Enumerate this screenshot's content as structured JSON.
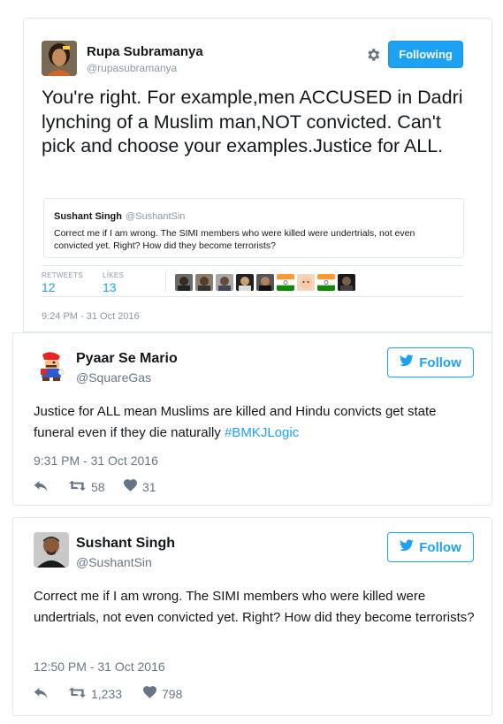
{
  "tweet_main": {
    "author_name": "Rupa Subramanya",
    "author_handle": "@rupasubramanya",
    "following_label": "Following",
    "text": "You're right. For example,men ACCUSED in Dadri lynching of a Muslim man,NOT convicted. Can't pick and choose your examples.Justice for ALL.",
    "quote": {
      "author_name": "Sushant Singh",
      "author_handle": "@SushantSin",
      "text": "Correct me if I am wrong. The SIMI members who were killed were undertrials, not even convicted yet. Right? How did they become terrorists?"
    },
    "stats": {
      "retweets_label": "RETWEETS",
      "retweets_value": "12",
      "likes_label": "LIKES",
      "likes_value": "13"
    },
    "timestamp": "9:24 PM - 31 Oct 2016"
  },
  "tweet_mario": {
    "author_name": "Pyaar Se Mario",
    "author_handle": "@SquareGas",
    "follow_label": "Follow",
    "text_main": "Justice for ALL mean Muslims are killed and Hindu convicts get state funeral even if they die naturally ",
    "hashtag": "#BMKJLogic",
    "timestamp": "9:31 PM - 31 Oct 2016",
    "retweets": "58",
    "likes": "31"
  },
  "tweet_sushant": {
    "author_name": "Sushant Singh",
    "author_handle": "@SushantSin",
    "follow_label": "Follow",
    "text": "Correct me if I am wrong. The SIMI members who were killed were undertrials, not even convicted yet. Right? How did they become terrorists?",
    "timestamp": "12:50 PM - 31 Oct 2016",
    "retweets": "1,233",
    "likes": "798"
  },
  "colors": {
    "accent": "#1da1f2",
    "muted": "#8899a6",
    "border": "#e1e8ed",
    "text": "#14171a"
  },
  "icons": [
    "gear-icon",
    "twitter-bird-icon",
    "reply-icon",
    "retweet-icon",
    "heart-icon"
  ]
}
